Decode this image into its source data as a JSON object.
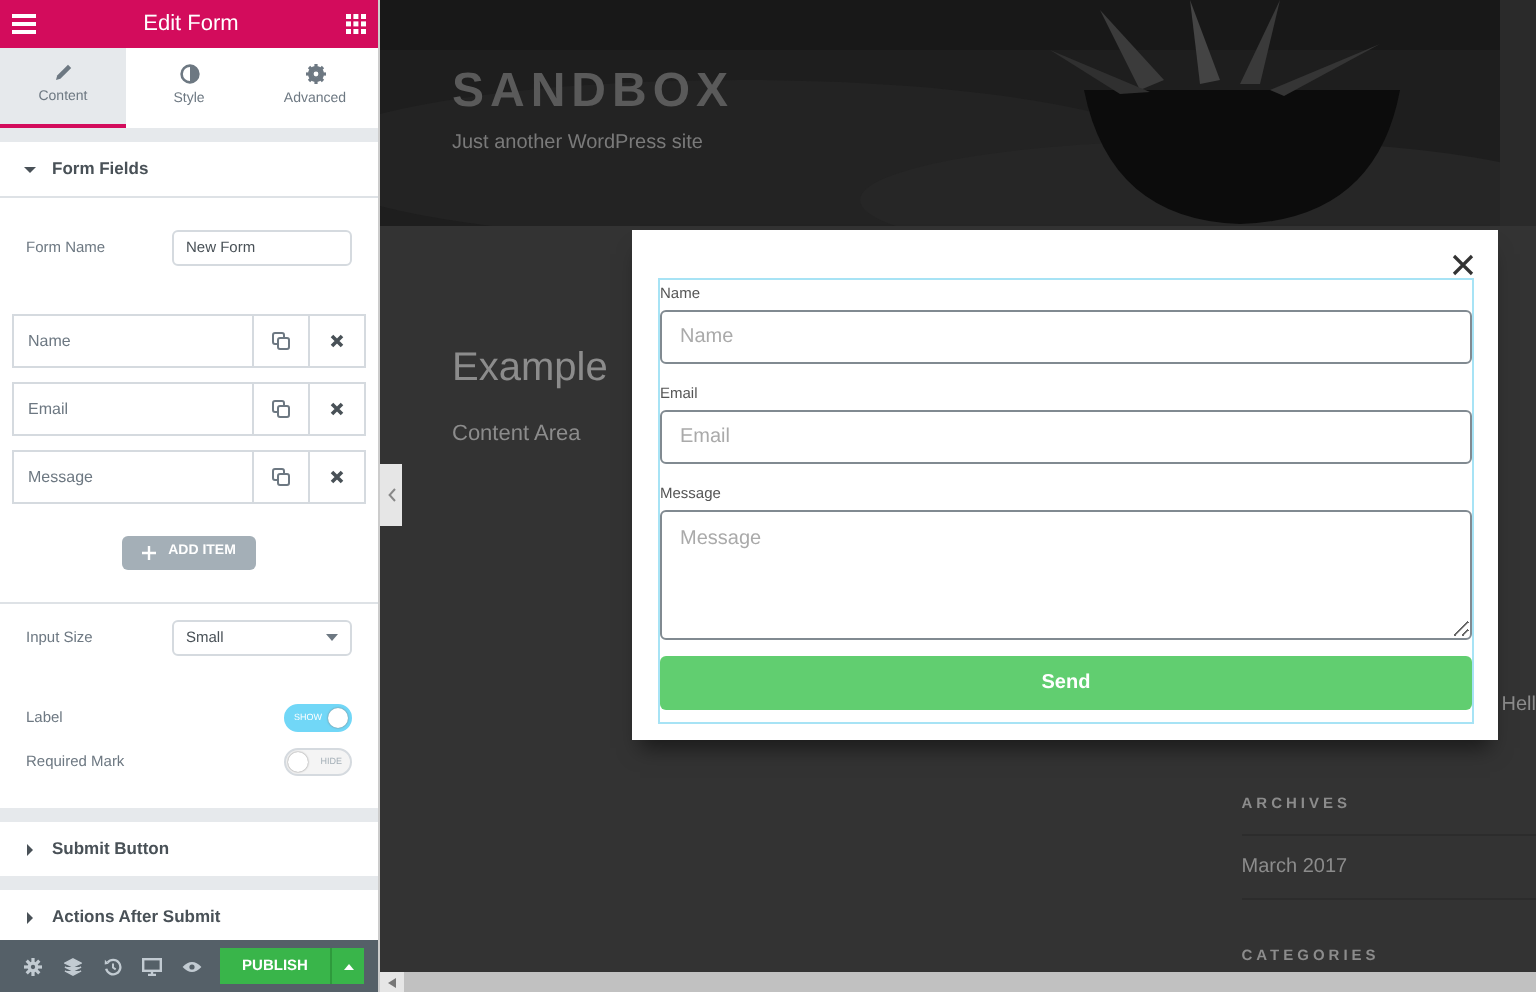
{
  "sidebar": {
    "title": "Edit Form",
    "tabs": [
      {
        "label": "Content",
        "selected": true
      },
      {
        "label": "Style",
        "selected": false
      },
      {
        "label": "Advanced",
        "selected": false
      }
    ],
    "form_fields": {
      "title": "Form Fields",
      "expanded": true,
      "form_name": {
        "label": "Form Name",
        "value": "New Form"
      },
      "items": [
        {
          "label": "Name"
        },
        {
          "label": "Email"
        },
        {
          "label": "Message"
        }
      ],
      "add_button": "ADD ITEM",
      "input_size": {
        "label": "Input Size",
        "value": "Small"
      },
      "toggles": [
        {
          "label": "Label",
          "on": true,
          "text": "SHOW"
        },
        {
          "label": "Required Mark",
          "on": false,
          "text": "HIDE"
        }
      ]
    },
    "sections": [
      {
        "title": "Submit Button",
        "expanded": false
      },
      {
        "title": "Actions After Submit",
        "expanded": false
      }
    ],
    "publish": "PUBLISH"
  },
  "preview": {
    "site_title": "SANDBOX",
    "tagline": "Just another WordPress site",
    "heading": "Example",
    "content": "Content Area",
    "cut_text": "Hell",
    "widgets": [
      {
        "title": "ARCHIVES",
        "items": [
          "March 2017"
        ]
      },
      {
        "title": "CATEGORIES"
      }
    ]
  },
  "popup": {
    "fields": [
      {
        "kind": "input",
        "label": "Name",
        "placeholder": "Name"
      },
      {
        "kind": "input",
        "label": "Email",
        "placeholder": "Email"
      },
      {
        "kind": "textarea",
        "label": "Message",
        "placeholder": "Message"
      }
    ],
    "submit": "Send"
  }
}
